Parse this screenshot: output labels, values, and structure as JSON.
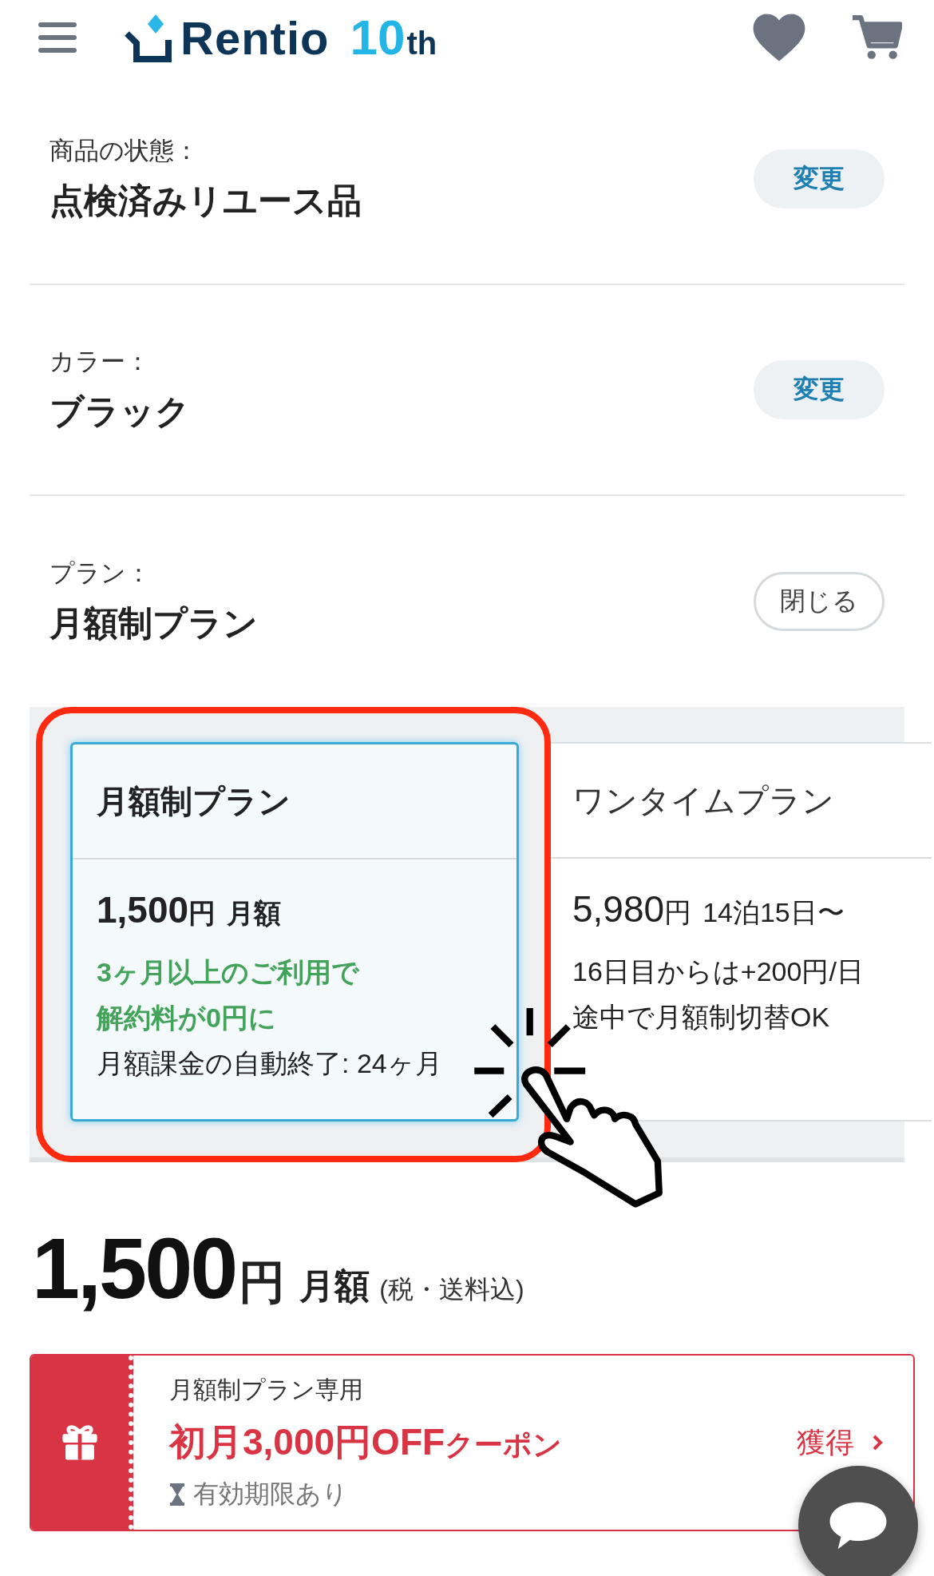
{
  "header": {
    "logo": {
      "name": "Rentio",
      "badge": "10",
      "suffix": "th"
    }
  },
  "options": [
    {
      "label": "商品の状態：",
      "value": "点検済みリユース品",
      "button": "変更",
      "kind": "change"
    },
    {
      "label": "カラー：",
      "value": "ブラック",
      "button": "変更",
      "kind": "change"
    },
    {
      "label": "プラン：",
      "value": "月額制プラン",
      "button": "閉じる",
      "kind": "close"
    }
  ],
  "plans": [
    {
      "name": "月額制プラン",
      "price": "1,500",
      "unit": "円",
      "period": "月額",
      "selected": true,
      "notes": [
        {
          "text": "3ヶ月以上のご利用で",
          "kind": "promo"
        },
        {
          "text": "解約料が0円に",
          "kind": "promo"
        },
        {
          "text": "月額課金の自動終了: 24ヶ月",
          "kind": "plain"
        }
      ]
    },
    {
      "name": "ワンタイムプラン",
      "price": "5,980",
      "unit": "円",
      "period": "14泊15日〜",
      "selected": false,
      "notes": [
        {
          "text": "16日目からは+200円/日",
          "kind": "plain"
        },
        {
          "text": "途中で月額制切替OK",
          "kind": "plain"
        }
      ]
    }
  ],
  "total": {
    "price": "1,500",
    "unit": "円",
    "period": "月額",
    "tax": "(税・送料込)"
  },
  "coupon": {
    "tag": "月額制プラン専用",
    "title": "初月3,000円OFF",
    "suffix": "クーポン",
    "expiry": "有効期限あり",
    "action": "獲得"
  }
}
